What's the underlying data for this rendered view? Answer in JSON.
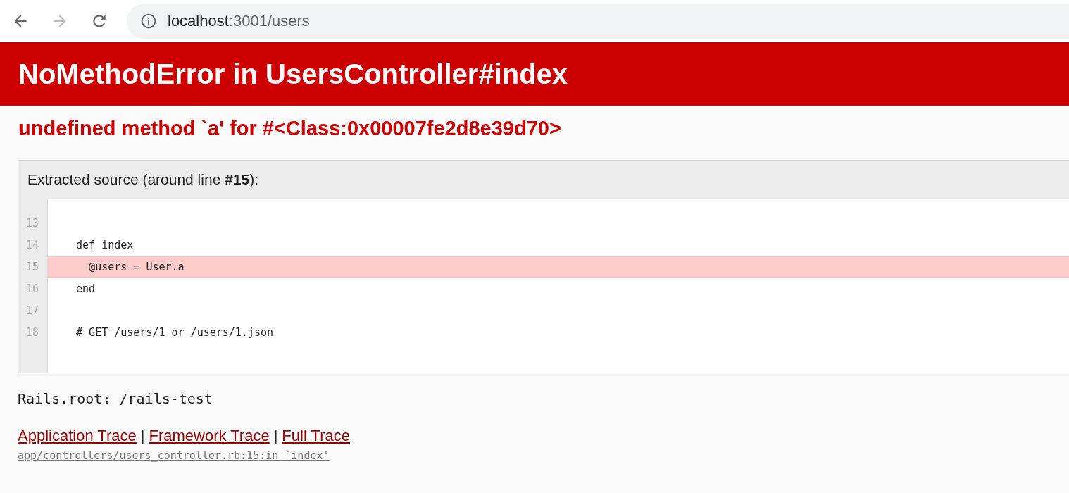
{
  "browser": {
    "url_host": "localhost",
    "url_path": ":3001/users",
    "forward_disabled": true
  },
  "header": {
    "title": "NoMethodError in UsersController#index"
  },
  "message": "undefined method `a' for #<Class:0x00007fe2d8e39d70>",
  "source": {
    "title": "Extracted source (around line **#15**):",
    "lines": [
      {
        "number": "13",
        "highlighted": false
      },
      {
        "number": "14",
        "code": "  def index",
        "highlighted": false
      },
      {
        "number": "15",
        "code": "    @users = User.a",
        "highlighted": true
      },
      {
        "number": "16",
        "code": "  end",
        "highlighted": false
      },
      {
        "number": "17",
        "highlighted": false
      },
      {
        "number": "18",
        "code": "  # GET /users/1 or /users/1.json",
        "highlighted": false
      }
    ]
  },
  "rails_root": "Rails.root: /rails-test",
  "trace_links": [
    "Application Trace",
    "Framework Trace",
    "Full Trace"
  ],
  "trace_separators": [
    "|",
    "|"
  ],
  "trace_line": "app/controllers/users_controller.rb:15:in `index'"
}
